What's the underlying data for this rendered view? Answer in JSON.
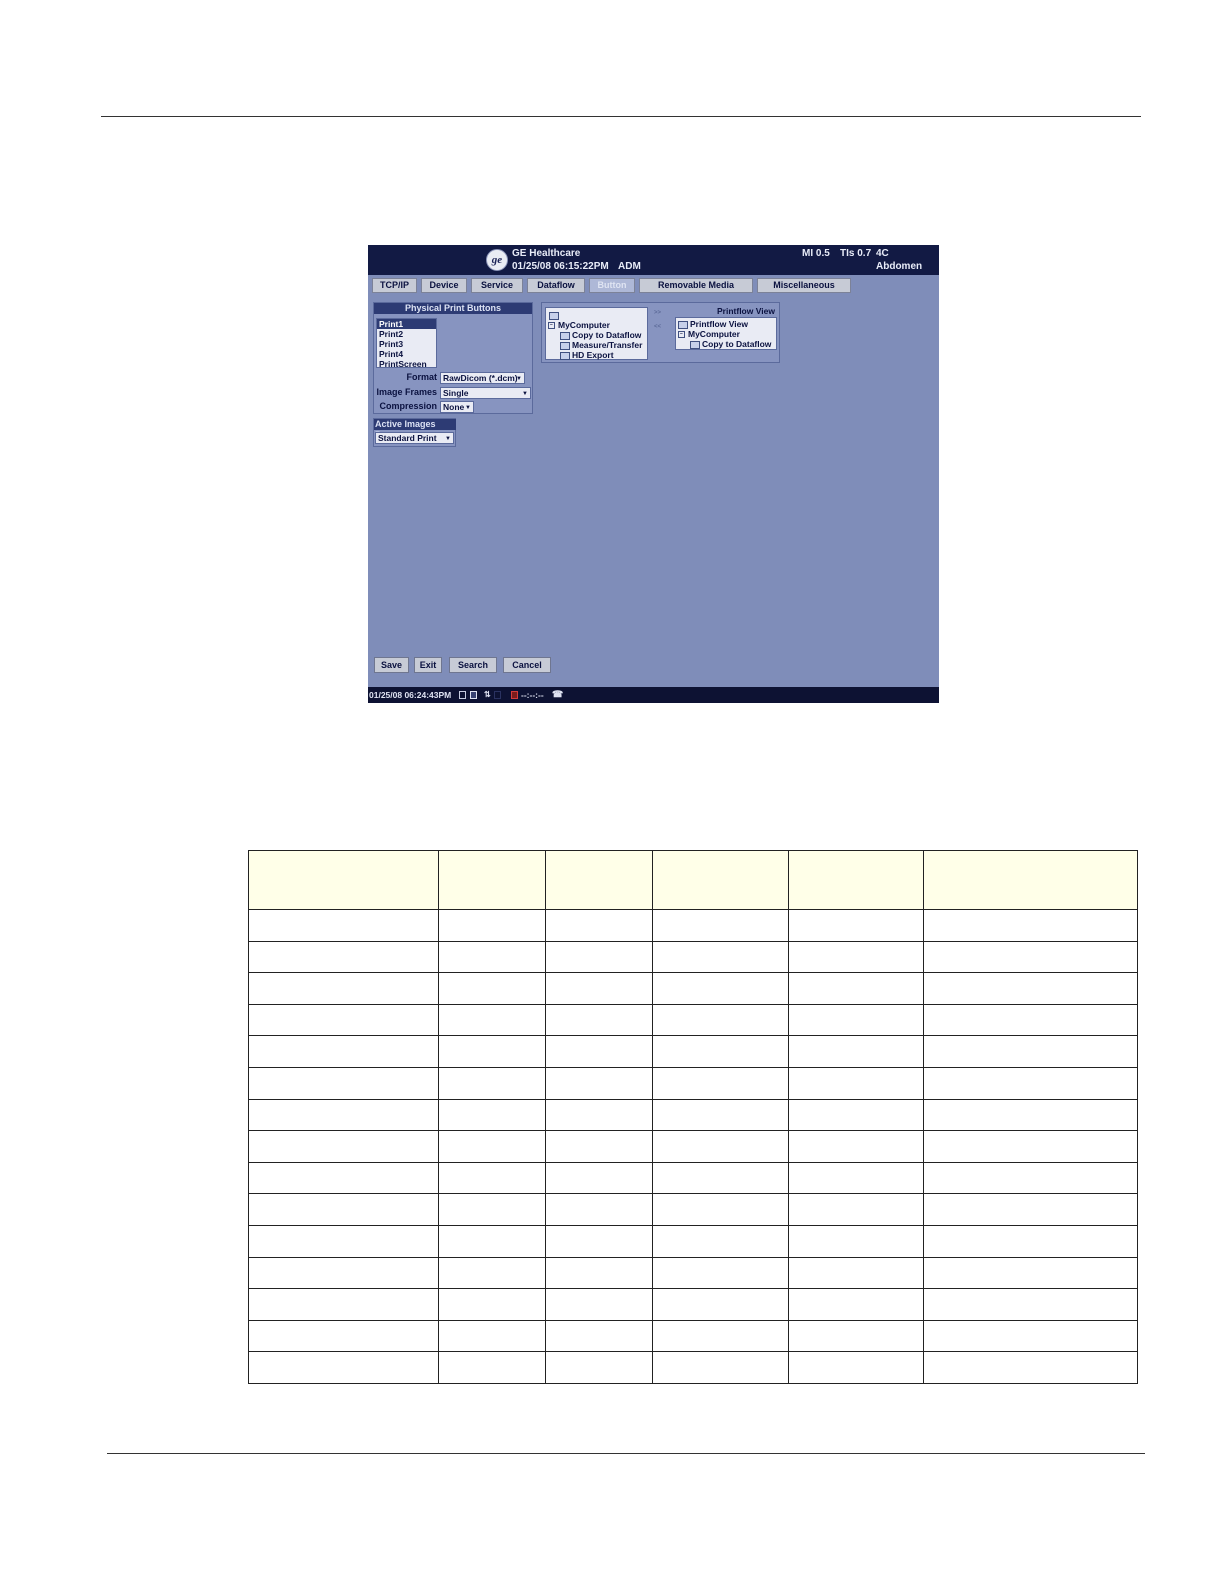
{
  "topbar": {
    "brand": "GE Healthcare",
    "datetime": "01/25/08 06:15:22PM",
    "user": "ADM",
    "mi": "MI 0.5",
    "tis": "TIs 0.7",
    "probe": "4C",
    "preset": "Abdomen"
  },
  "tabs": [
    "TCP/IP",
    "Device",
    "Service",
    "Dataflow",
    "Button",
    "Removable Media",
    "Miscellaneous"
  ],
  "active_tab": "Button",
  "print_buttons": {
    "title": "Physical Print Buttons",
    "items": [
      "Print1",
      "Print2",
      "Print3",
      "Print4",
      "PrintScreen"
    ],
    "selected": "Print1",
    "format_label": "Format",
    "format_value": "RawDicom (*.dcm)",
    "frames_label": "Image Frames",
    "frames_value": "Single",
    "compression_label": "Compression",
    "compression_value": "None"
  },
  "active_images": {
    "title": "Active Images Page",
    "value": "Standard Print"
  },
  "source_tree": {
    "root": "MyComputer",
    "children": [
      "Copy to Dataflow",
      "Measure/Transfer",
      "HD Export"
    ]
  },
  "move_buttons": [
    ">>",
    "<<"
  ],
  "printflow": {
    "title": "Printflow View",
    "root": "Printflow View",
    "node": "MyComputer",
    "child": "Copy to Dataflow"
  },
  "buttons": {
    "save": "Save",
    "exit": "Exit",
    "search": "Search",
    "cancel": "Cancel"
  },
  "statusbar": {
    "datetime": "01/25/08 06:24:43PM",
    "timer": "--:--:--"
  },
  "table": {
    "columns": 6,
    "body_rows": 15
  }
}
